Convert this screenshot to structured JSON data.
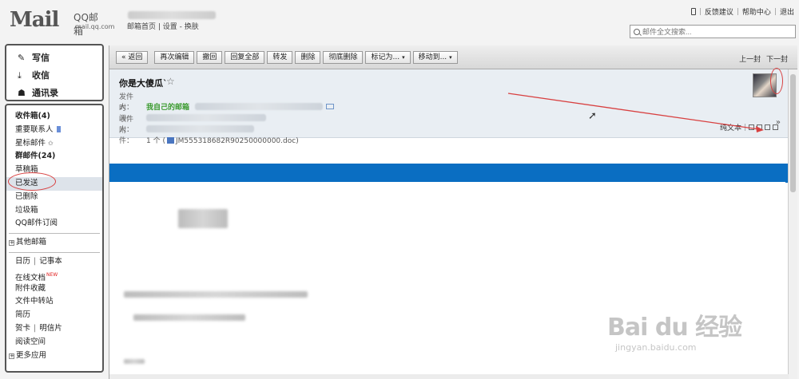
{
  "brand": {
    "logo_text": "Mail",
    "qq_text": "QQ邮箱",
    "domain": "mail.qq.com"
  },
  "header": {
    "home": "邮箱首页",
    "sep": " | ",
    "settings": "设置",
    "dash": " - ",
    "skin": "换肤",
    "feedback": "反馈建议",
    "help": "帮助中心",
    "logout": "退出",
    "search_placeholder": "邮件全文搜索..."
  },
  "sidebar": {
    "compose": "写信",
    "inbox": "收信",
    "contacts": "通讯录",
    "folders": {
      "inbox": "收件箱(4)",
      "important": "重要联系人",
      "starred": "星标邮件",
      "group": "群邮件(24)",
      "drafts": "草稿箱",
      "sent": "已发送",
      "deleted": "已删除",
      "trash": "垃圾箱",
      "subscribe": "QQ邮件订阅",
      "other": "其他邮箱",
      "calendar": "日历",
      "notes": "记事本",
      "docs": "在线文档",
      "new_badge": "NEW",
      "attachments": "附件收藏",
      "transfer": "文件中转站",
      "resume": "简历",
      "cards": "贺卡",
      "postcards": "明信片",
      "reading": "阅读空间",
      "more_apps": "更多应用"
    }
  },
  "toolbar": {
    "back": "« 返回",
    "reedit": "再次编辑",
    "recall": "撤回",
    "reply_all": "回复全部",
    "forward": "转发",
    "delete": "删除",
    "perm_delete": "彻底删除",
    "mark": "标记为...",
    "move": "移动到...",
    "prev": "上一封",
    "next": "下一封"
  },
  "mail": {
    "subject": "你是大傻瓜`",
    "from_label": "发件人：",
    "from_name": "我自己的邮箱",
    "time_label": "时　间：",
    "to_label": "收件人：",
    "attach_label": "附　件：",
    "attach_count": "1 个 (",
    "attach_name": "JM555318682R90250000000.doc",
    "attach_close": ")",
    "plain_text": "纯文本"
  },
  "watermark": {
    "main": "Bai du 经验",
    "url": "jingyan.baidu.com"
  },
  "colors": {
    "accent_blue": "#0a6ec2",
    "annotation_red": "#d84040",
    "sender_green": "#3a9a2e"
  }
}
